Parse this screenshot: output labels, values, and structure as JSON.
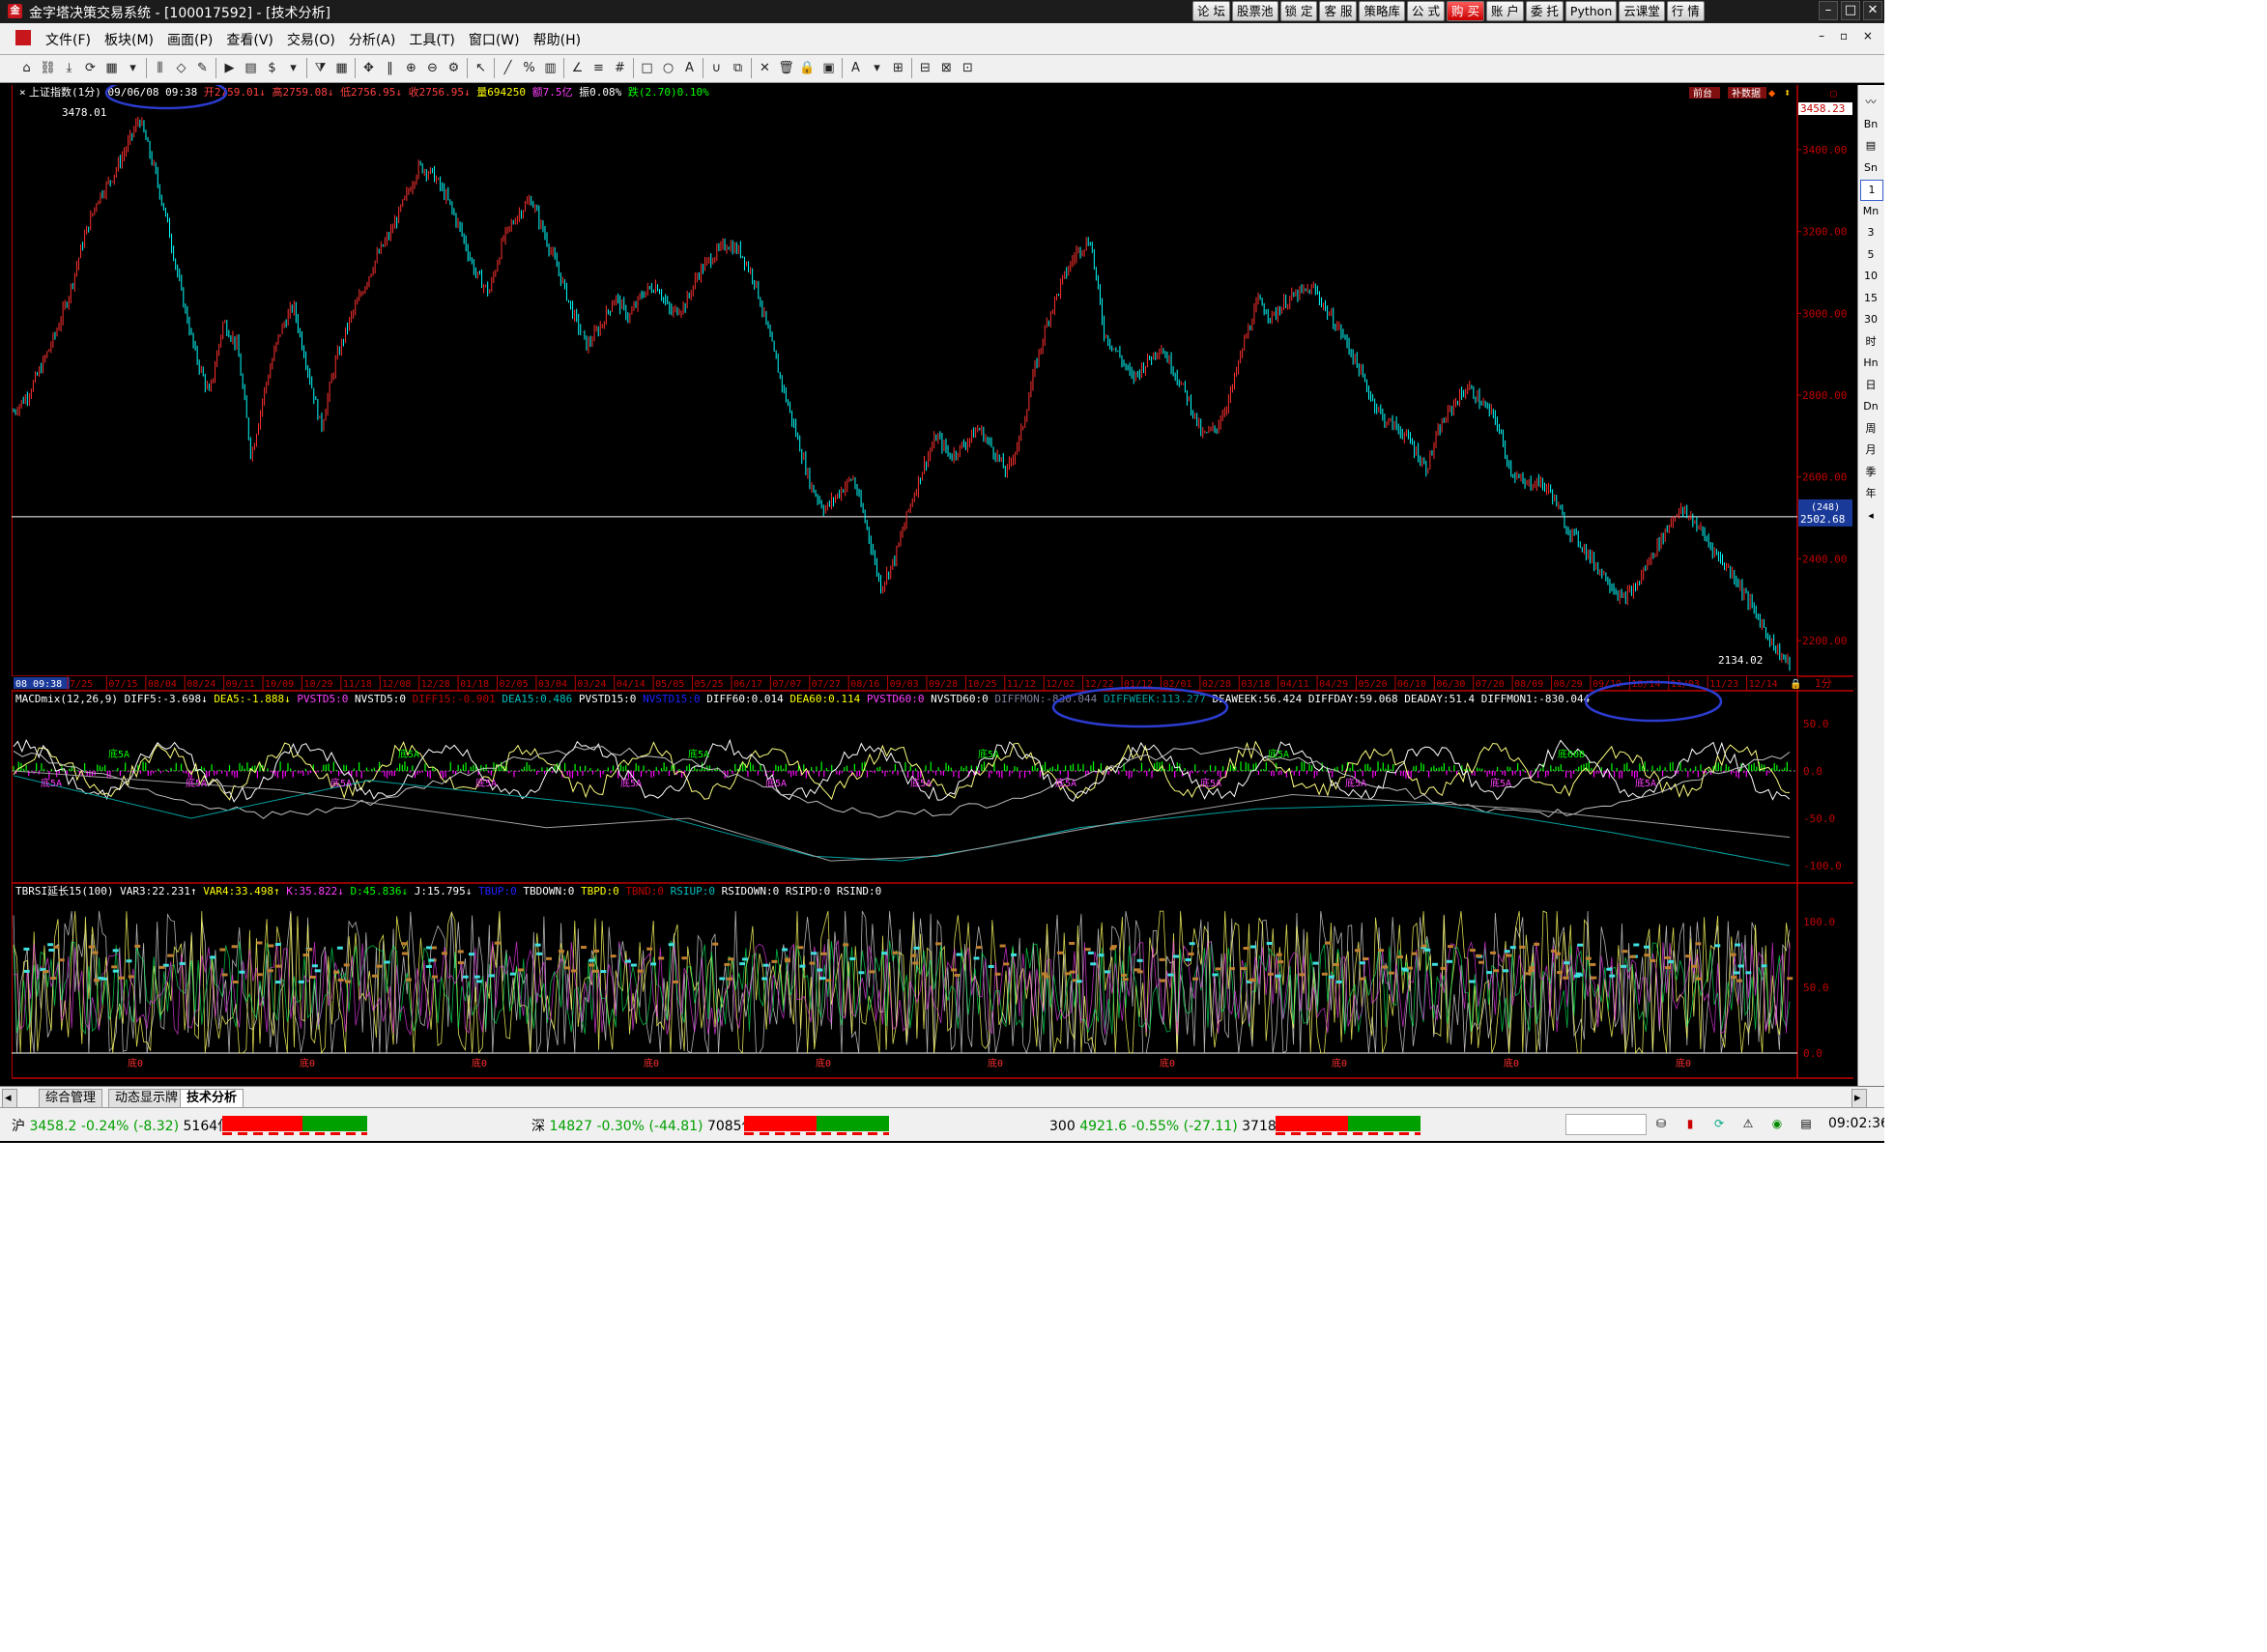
{
  "window": {
    "title": "金字塔决策交易系统 - [100017592] - [技术分析]",
    "logo": "金"
  },
  "top_buttons": [
    {
      "label": "论 坛",
      "hot": false
    },
    {
      "label": "股票池",
      "hot": false
    },
    {
      "label": "锁 定",
      "hot": false
    },
    {
      "label": "客 服",
      "hot": false
    },
    {
      "label": "策略库",
      "hot": false
    },
    {
      "label": "公 式",
      "hot": false
    },
    {
      "label": "购 买",
      "hot": true
    },
    {
      "label": "账 户",
      "hot": false
    },
    {
      "label": "委 托",
      "hot": false
    },
    {
      "label": "Python",
      "hot": false
    },
    {
      "label": "云课堂",
      "hot": false
    },
    {
      "label": "行 情",
      "hot": false
    }
  ],
  "window_controls": [
    "–",
    "□",
    "✕"
  ],
  "menu": [
    "文件(F)",
    "板块(M)",
    "画面(P)",
    "查看(V)",
    "交易(O)",
    "分析(A)",
    "工具(T)",
    "窗口(W)",
    "帮助(H)"
  ],
  "mdi_controls": "– ▫ ×",
  "toolbar_icons": [
    {
      "name": "home-icon",
      "glyph": "⌂"
    },
    {
      "name": "link-icon",
      "glyph": "⛓"
    },
    {
      "name": "download-icon",
      "glyph": "⤓"
    },
    {
      "name": "refresh-icon",
      "glyph": "⟳"
    },
    {
      "name": "grid-icon",
      "glyph": "▦"
    },
    {
      "name": "dropdown-icon",
      "glyph": "▾"
    },
    {
      "name": "bar-chart-icon",
      "glyph": "⫼"
    },
    {
      "name": "diamond-icon",
      "glyph": "◇"
    },
    {
      "name": "edit-icon",
      "glyph": "✎"
    },
    {
      "name": "play-icon",
      "glyph": "▶"
    },
    {
      "name": "page-icon",
      "glyph": "▤"
    },
    {
      "name": "dollar-icon",
      "glyph": "$"
    },
    {
      "name": "dropdown-icon",
      "glyph": "▾"
    },
    {
      "name": "filter-icon",
      "glyph": "⧩"
    },
    {
      "name": "table-icon",
      "glyph": "▦"
    },
    {
      "name": "move-icon",
      "glyph": "✥"
    },
    {
      "name": "column-icon",
      "glyph": "‖"
    },
    {
      "name": "zoom-in-icon",
      "glyph": "⊕"
    },
    {
      "name": "zoom-out-icon",
      "glyph": "⊖"
    },
    {
      "name": "gear-icon",
      "glyph": "⚙"
    },
    {
      "name": "cursor-icon",
      "glyph": "↖"
    },
    {
      "name": "line-tool-icon",
      "glyph": "╱"
    },
    {
      "name": "percent-icon",
      "glyph": "%"
    },
    {
      "name": "grid2-icon",
      "glyph": "▥"
    },
    {
      "name": "angle-icon",
      "glyph": "∠"
    },
    {
      "name": "hlines-icon",
      "glyph": "≡"
    },
    {
      "name": "hash-icon",
      "glyph": "#"
    },
    {
      "name": "rect-icon",
      "glyph": "□"
    },
    {
      "name": "circle-icon",
      "glyph": "○"
    },
    {
      "name": "text-icon",
      "glyph": "A"
    },
    {
      "name": "magnet-icon",
      "glyph": "∪"
    },
    {
      "name": "copy-icon",
      "glyph": "⧉"
    },
    {
      "name": "close-icon",
      "glyph": "✕"
    },
    {
      "name": "trash-icon",
      "glyph": "🗑"
    },
    {
      "name": "lock-icon",
      "glyph": "🔒"
    },
    {
      "name": "save-icon",
      "glyph": "▣"
    },
    {
      "name": "font-color-icon",
      "glyph": "A"
    },
    {
      "name": "dropdown-icon",
      "glyph": "▾"
    },
    {
      "name": "tile-icon",
      "glyph": "⊞"
    },
    {
      "name": "tile2-icon",
      "glyph": "⊟"
    },
    {
      "name": "tile3-icon",
      "glyph": "⊠"
    },
    {
      "name": "tile4-icon",
      "glyph": "⊡"
    }
  ],
  "main_header": {
    "symbol": "上证指数(1分)",
    "date": "09/06/08 09:38",
    "open": "开2759.01↓",
    "high": "高2759.08↓",
    "low": "低2756.95↓",
    "close": "收2756.95↓",
    "volume": "量694250",
    "amount": "额7.5亿",
    "amplitude": "振0.08%",
    "change": "跌(2.70)0.10%"
  },
  "main_axis": {
    "labels": [
      "3400.00",
      "3200.00",
      "3000.00",
      "2800.00",
      "2600.00",
      "2400.00",
      "2200.00"
    ],
    "current": "3458.23",
    "cursor_tag": "(248)",
    "cursor_value": "2502.68",
    "ylim": [
      2134.02,
      3478.01
    ]
  },
  "main_annotations": {
    "high": "3478.01",
    "low": "2134.02",
    "btn1": "前台",
    "btn2": "补数据"
  },
  "series": {
    "x_range": [
      0,
      1
    ],
    "y": [
      2760,
      2800,
      2870,
      2950,
      3050,
      3180,
      3280,
      3330,
      3400,
      3478,
      3360,
      3220,
      3050,
      2900,
      2800,
      2980,
      2920,
      2650,
      2820,
      2950,
      3020,
      2870,
      2720,
      2880,
      2980,
      3060,
      3140,
      3200,
      3280,
      3360,
      3340,
      3280,
      3200,
      3100,
      3050,
      3180,
      3240,
      3280,
      3190,
      3100,
      3000,
      2920,
      2970,
      3040,
      2990,
      3050,
      3070,
      3000,
      3020,
      3100,
      3140,
      3170,
      3150,
      3080,
      2950,
      2820,
      2700,
      2580,
      2520,
      2560,
      2600,
      2480,
      2330,
      2400,
      2520,
      2620,
      2700,
      2650,
      2680,
      2720,
      2670,
      2610,
      2700,
      2860,
      2990,
      3080,
      3150,
      3180,
      2950,
      2900,
      2840,
      2880,
      2920,
      2860,
      2790,
      2700,
      2720,
      2800,
      2930,
      3030,
      2990,
      3030,
      3050,
      3060,
      3000,
      2950,
      2880,
      2800,
      2740,
      2720,
      2680,
      2620,
      2720,
      2780,
      2820,
      2780,
      2740,
      2620,
      2580,
      2590,
      2560,
      2480,
      2440,
      2390,
      2350,
      2300,
      2330,
      2400,
      2460,
      2520,
      2500,
      2450,
      2400,
      2360,
      2300,
      2240,
      2180,
      2140
    ]
  },
  "date_axis": {
    "cursor": "08 09:38",
    "labels": [
      "7/25",
      "07/15",
      "08/04",
      "08/24",
      "09/11",
      "10/09",
      "10/29",
      "11/18",
      "12/08",
      "12/28",
      "01/18",
      "02/05",
      "03/04",
      "03/24",
      "04/14",
      "05/05",
      "05/25",
      "06/17",
      "07/07",
      "07/27",
      "08/16",
      "09/03",
      "09/28",
      "10/25",
      "11/12",
      "12/02",
      "12/22",
      "01/12",
      "02/01",
      "02/28",
      "03/18",
      "04/11",
      "04/29",
      "05/20",
      "06/10",
      "06/30",
      "07/20",
      "08/09",
      "08/29",
      "09/19",
      "10/14",
      "11/03",
      "11/23",
      "12/14"
    ],
    "period": "1分"
  },
  "macd": {
    "header": [
      {
        "t": "MACDmix(12,26,9)",
        "c": "#ffffff"
      },
      {
        "t": "DIFF5:-3.698↓",
        "c": "#ffffff"
      },
      {
        "t": "DEA5:-1.888↓",
        "c": "#ffff00"
      },
      {
        "t": "PVSTD5:0",
        "c": "#ff40ff"
      },
      {
        "t": "NVSTD5:0",
        "c": "#ffffff"
      },
      {
        "t": "DIFF15:-0.901",
        "c": "#c00000"
      },
      {
        "t": "DEA15:0.486",
        "c": "#00c0c0"
      },
      {
        "t": "PVSTD15:0",
        "c": "#ffffff"
      },
      {
        "t": "NVSTD15:0",
        "c": "#2020ff"
      },
      {
        "t": "DIFF60:0.014",
        "c": "#ffffff"
      },
      {
        "t": "DEA60:0.114",
        "c": "#ffff00"
      },
      {
        "t": "PVSTD60:0",
        "c": "#ff40ff"
      },
      {
        "t": "NVSTD60:0",
        "c": "#ffffff"
      },
      {
        "t": "DIFFMON:-830.044",
        "c": "#8080a0"
      },
      {
        "t": "DIFFWEEK:113.277",
        "c": "#00a0a0"
      },
      {
        "t": "DEAWEEK:56.424",
        "c": "#ffffff"
      },
      {
        "t": "DIFFDAY:59.068",
        "c": "#ffffff"
      },
      {
        "t": "DEADAY:51.4",
        "c": "#ffffff"
      },
      {
        "t": "DIFFMON1:-830.044",
        "c": "#ffffff"
      }
    ],
    "axis": [
      "50.0",
      "0.0",
      "-50.0",
      "-100.0"
    ],
    "labels": [
      "底5A",
      "底5A",
      "底5A",
      "底5A",
      "底5A",
      "底5A",
      "底5A",
      "底5A",
      "底5A",
      "底5A",
      "底5A",
      "底5A"
    ],
    "green_labels": [
      "底5A",
      "底5A",
      "底5A",
      "底5A",
      "底5A",
      "底60B"
    ]
  },
  "tbrsi": {
    "header": [
      {
        "t": "TBRSI延长15(100)",
        "c": "#ffffff"
      },
      {
        "t": "VAR3:22.231↑",
        "c": "#ffffff"
      },
      {
        "t": "VAR4:33.498↑",
        "c": "#ffff00"
      },
      {
        "t": "K:35.822↓",
        "c": "#ff40ff"
      },
      {
        "t": "D:45.836↓",
        "c": "#00ff00"
      },
      {
        "t": "J:15.795↓",
        "c": "#ffffff"
      },
      {
        "t": "TBUP:0",
        "c": "#2020ff"
      },
      {
        "t": "TBDOWN:0",
        "c": "#ffffff"
      },
      {
        "t": "TBPD:0",
        "c": "#ffff00"
      },
      {
        "t": "TBND:0",
        "c": "#c00000"
      },
      {
        "t": "RSIUP:0",
        "c": "#00c0c0"
      },
      {
        "t": "RSIDOWN:0",
        "c": "#ffffff"
      },
      {
        "t": "RSIPD:0",
        "c": "#ffffff"
      },
      {
        "t": "RSIND:0",
        "c": "#ffffff"
      }
    ],
    "axis": [
      "100.0",
      "50.0",
      "0.0"
    ],
    "labels": [
      "底0",
      "底0",
      "底0",
      "底0",
      "底0",
      "底0",
      "底0",
      "底0",
      "底0",
      "底0"
    ]
  },
  "right_strip": [
    {
      "t": "〰",
      "sel": false
    },
    {
      "t": "Bn",
      "sel": false
    },
    {
      "t": "▤",
      "sel": false
    },
    {
      "t": "Sn",
      "sel": false
    },
    {
      "t": "1",
      "sel": true
    },
    {
      "t": "Mn",
      "sel": false
    },
    {
      "t": "3",
      "sel": false
    },
    {
      "t": "5",
      "sel": false
    },
    {
      "t": "10",
      "sel": false
    },
    {
      "t": "15",
      "sel": false
    },
    {
      "t": "30",
      "sel": false
    },
    {
      "t": "时",
      "sel": false
    },
    {
      "t": "Hn",
      "sel": false
    },
    {
      "t": "日",
      "sel": false
    },
    {
      "t": "Dn",
      "sel": false
    },
    {
      "t": "周",
      "sel": false
    },
    {
      "t": "月",
      "sel": false
    },
    {
      "t": "季",
      "sel": false
    },
    {
      "t": "年",
      "sel": false
    },
    {
      "t": "◂",
      "sel": false
    }
  ],
  "tabs": [
    "综合管理",
    "动态显示牌",
    "技术分析"
  ],
  "active_tab": 2,
  "status": {
    "sh": {
      "label": "沪",
      "price": "3458.2",
      "pct": "-0.24%",
      "chg": "(-8.32)",
      "amt": "5164亿"
    },
    "sz": {
      "label": "深",
      "price": "14827",
      "pct": "-0.30%",
      "chg": "(-44.81)",
      "amt": "7085亿"
    },
    "hs300": {
      "label": "300",
      "price": "4921.6",
      "pct": "-0.55%",
      "chg": "(-27.11)",
      "amt": "3718亿"
    },
    "time": "09:02:36"
  },
  "colors": {
    "up": "#ff3030",
    "down": "#00ffff",
    "axis": "#c00000",
    "grid": "#800000",
    "annotation": "#2c3cd0"
  }
}
